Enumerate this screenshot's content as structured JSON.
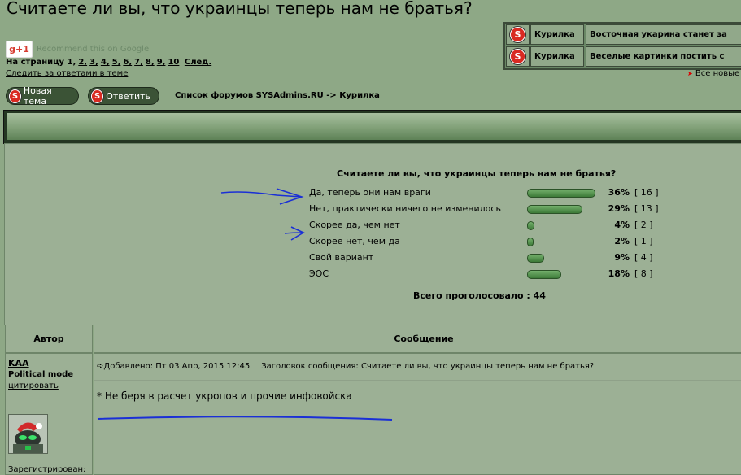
{
  "title": "Считаете ли вы, что украинцы теперь нам не братья?",
  "gplus": {
    "button_label": "g+1",
    "text": "Recommend this on Google"
  },
  "pager": {
    "prefix": "На страницу",
    "current": "1,",
    "pages": [
      "2,",
      "3,",
      "4,",
      "5,",
      "6,",
      "7,",
      "8,",
      "9,",
      "10"
    ],
    "next": "След."
  },
  "watch_link": "Следить за ответами в теме",
  "related_topics": [
    {
      "forum": "Курилка",
      "topic": "Восточная укарина станет за"
    },
    {
      "forum": "Курилка",
      "topic": "Веселые картинки постить с"
    }
  ],
  "all_topics": "Все новые",
  "buttons": {
    "new_topic": "Новая тема",
    "reply": "Ответить",
    "icon_letter": "S"
  },
  "breadcrumb": "Список форумов SYSAdmins.RU -> Курилка",
  "poll": {
    "question": "Считаете ли вы, что украинцы теперь нам не братья?",
    "options": [
      {
        "label": "Да, теперь они нам враги",
        "percent": "36%",
        "count": "[ 16 ]",
        "bar_fraction": 0.36
      },
      {
        "label": "Нет, практически ничего не изменилось",
        "percent": "29%",
        "count": "[ 13 ]",
        "bar_fraction": 0.29
      },
      {
        "label": "Скорее да, чем нет",
        "percent": "4%",
        "count": "[ 2 ]",
        "bar_fraction": 0.04
      },
      {
        "label": "Скорее нет, чем да",
        "percent": "2%",
        "count": "[ 1 ]",
        "bar_fraction": 0.02
      },
      {
        "label": "Свой вариант",
        "percent": "9%",
        "count": "[ 4 ]",
        "bar_fraction": 0.09
      },
      {
        "label": "ЭОС",
        "percent": "18%",
        "count": "[ 8 ]",
        "bar_fraction": 0.18
      }
    ],
    "total": "Всего проголосовало : 44"
  },
  "table_headers": {
    "author": "Автор",
    "message": "Сообщение"
  },
  "post": {
    "author": "KAA",
    "rank": "Political mode",
    "quote_link": "цитировать",
    "registered": "Зарегистрирован:",
    "added": "Добавлено: Пт 03 Апр, 2015 12:45",
    "subject": "Заголовок сообщения: Считаете ли вы, что украинцы теперь нам не братья?",
    "body": "* Не беря в расчет укропов и прочие инфовойска"
  },
  "colors": {
    "background": "#8ea886",
    "panel": "#9cb095",
    "ink": "#1a2fd6",
    "icon_red": "#d92a22"
  }
}
